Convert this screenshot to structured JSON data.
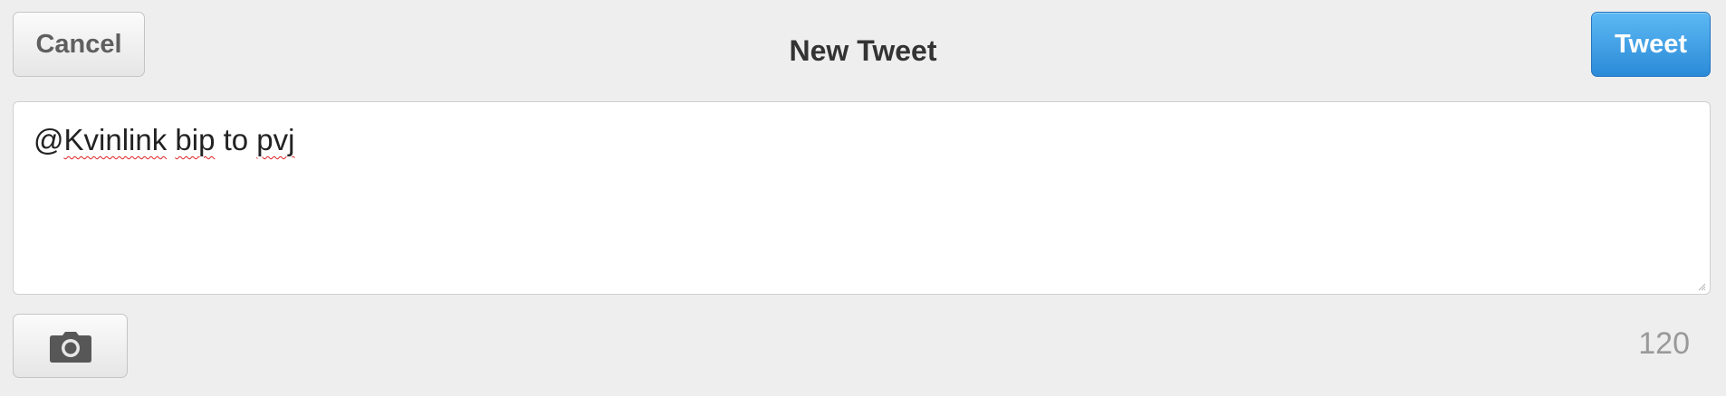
{
  "header": {
    "cancel_label": "Cancel",
    "title": "New Tweet",
    "tweet_label": "Tweet"
  },
  "compose": {
    "text": "@Kvinlink bip to pvj",
    "text_parts": [
      "@",
      "Kvinlink",
      " ",
      "bip",
      " to ",
      "pvj"
    ],
    "misspelled_words": [
      "Kvinlink",
      "bip",
      "pvj"
    ]
  },
  "footer": {
    "camera_icon": "camera-icon",
    "char_count": "120"
  },
  "colors": {
    "background": "#eeeeee",
    "tweet_button": "#2b8ad8",
    "spellcheck_underline": "#e02020",
    "counter": "#999999"
  }
}
